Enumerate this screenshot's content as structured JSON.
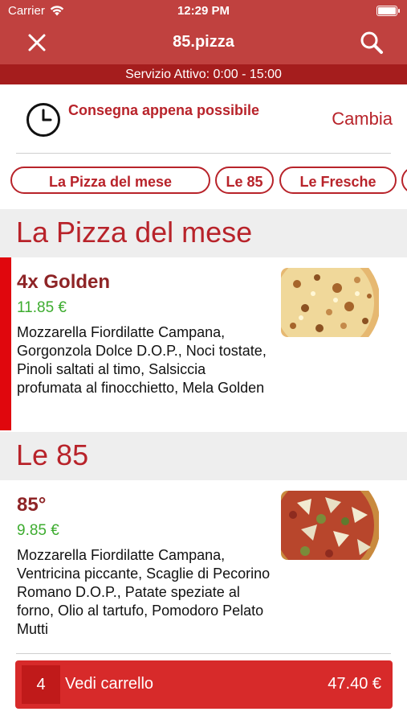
{
  "status_bar": {
    "carrier": "Carrier",
    "time": "12:29 PM"
  },
  "header": {
    "title": "85.pizza",
    "close_icon": "close-icon",
    "search_icon": "search-icon"
  },
  "service": {
    "text": "Servizio Attivo: 0:00 - 15:00"
  },
  "delivery": {
    "label": "Consegna appena possibile",
    "change_label": "Cambia",
    "icon": "clock-icon"
  },
  "categories": [
    {
      "label": "La Pizza del mese"
    },
    {
      "label": "Le 85"
    },
    {
      "label": "Le Fresche"
    },
    {
      "label": ""
    }
  ],
  "sections": [
    {
      "title": "La Pizza del mese",
      "items": [
        {
          "name": "4x Golden",
          "price": "11.85 €",
          "description": "Mozzarella Fiordilatte Campana, Gorgonzola Dolce D.O.P., Noci tostate, Pinoli saltati al timo, Salsiccia profumata al finocchietto, Mela Golden"
        }
      ]
    },
    {
      "title": "Le 85",
      "items": [
        {
          "name": "85°",
          "price": "9.85 €",
          "description": "Mozzarella Fiordilatte Campana, Ventricina piccante, Scaglie di Pecorino Romano D.O.P., Patate speziate al forno, Olio al tartufo, Pomodoro Pelato Mutti"
        }
      ]
    }
  ],
  "cart": {
    "count": "4",
    "label": "Vedi carrello",
    "total": "47.40 €"
  },
  "colors": {
    "header": "#c0413f",
    "service_bar": "#a51d1d",
    "accent": "#b8232a",
    "price": "#3dac2f",
    "cart": "#d72a2a"
  }
}
